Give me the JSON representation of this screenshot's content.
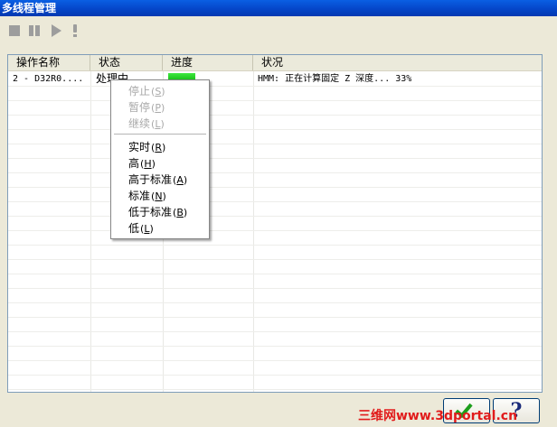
{
  "window": {
    "title": "多线程管理"
  },
  "toolbar": {
    "icons": [
      "stop-icon",
      "pause-icon",
      "play-icon",
      "exclamation-icon"
    ]
  },
  "list": {
    "columns": [
      "操作名称",
      "状态",
      "进度",
      "状况"
    ],
    "rows": [
      {
        "name": "2 - D32R0....",
        "status": "处理中",
        "progress": 0.33,
        "condition": "HMM:  正在计算固定 Z 深度... 33%"
      }
    ]
  },
  "context_menu": {
    "items": [
      {
        "label": "停止",
        "accel": "S",
        "enabled": false
      },
      {
        "label": "暂停",
        "accel": "P",
        "enabled": false
      },
      {
        "label": "继续",
        "accel": "L",
        "enabled": false
      },
      {
        "label": "实时",
        "accel": "R",
        "enabled": true
      },
      {
        "label": "高",
        "accel": "H",
        "enabled": true
      },
      {
        "label": "高于标准",
        "accel": "A",
        "enabled": true
      },
      {
        "label": "标准",
        "accel": "N",
        "enabled": true
      },
      {
        "label": "低于标准",
        "accel": "B",
        "enabled": true
      },
      {
        "label": "低",
        "accel": "L",
        "enabled": true
      }
    ]
  },
  "buttons": {
    "ok_icon": "checkmark-icon",
    "help_label": "?"
  },
  "watermark": {
    "text": "三维网www.3dportal.cn"
  },
  "colors": {
    "title_bar": "#0546c9",
    "progress_fill": "#13b913",
    "watermark": "#e11b1b",
    "disabled_text": "#a9a9a9"
  }
}
